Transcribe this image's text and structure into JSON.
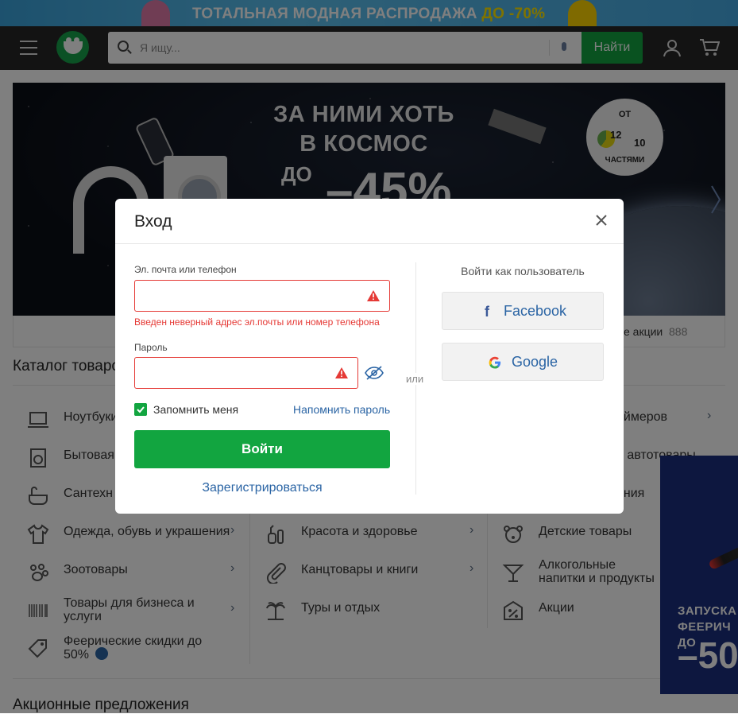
{
  "promo_bar": {
    "text_main": "ТОТАЛЬНАЯ МОДНАЯ РАСПРОДАЖА ",
    "text_highlight": "ДО -70%"
  },
  "header": {
    "search_placeholder": "Я ищу...",
    "find_button": "Найти",
    "icons": [
      "menu-icon",
      "logo-icon",
      "search-icon",
      "microphone-icon",
      "user-icon",
      "cart-icon"
    ]
  },
  "banner": {
    "headline": "ЗА НИМИ ХОТЬ В КОСМОС",
    "sub": "ДО",
    "percent": "–45%",
    "badge": {
      "from": "ОТ",
      "n1": "12",
      "n2": "10",
      "parts": "ЧАСТЯМИ"
    }
  },
  "promo_links": {
    "text": "е акции",
    "count": "888"
  },
  "catalog": {
    "title": "Каталог товаров",
    "col1": [
      {
        "label": "Ноутбуки",
        "icon": "laptop-icon"
      },
      {
        "label": "Бытовая",
        "icon": "washer-icon"
      },
      {
        "label": "Сантехн",
        "icon": "bathtub-icon"
      },
      {
        "label": "Одежда, обувь и украшения",
        "icon": "shirt-icon"
      },
      {
        "label": "Зоотовары",
        "icon": "paw-icon"
      },
      {
        "label": "Товары для бизнеса и услуги",
        "icon": "barcode-icon"
      },
      {
        "label": "Феерические скидки до 50%",
        "icon": "tag-icon"
      }
    ],
    "col2": [
      {
        "label": "Красота и здоровье",
        "icon": "cosmetics-icon"
      },
      {
        "label": "Канцтовары и книги",
        "icon": "paperclip-icon"
      },
      {
        "label": "Туры и отдых",
        "icon": "palm-icon"
      }
    ],
    "col3": [
      {
        "label": "еймеров",
        "icon": ""
      },
      {
        "label": "и автотовары",
        "icon": ""
      },
      {
        "label": "ения",
        "icon": ""
      },
      {
        "label": "Детские товары",
        "icon": "bear-icon"
      },
      {
        "label": "Алкогольные напитки и продукты",
        "icon": "cocktail-icon"
      },
      {
        "label": "Акции",
        "icon": "percent-tag-icon"
      }
    ]
  },
  "offers_title": "Акционные предложения",
  "side_ad": {
    "line1": "ЗАПУСКА",
    "line2": "ФЕЕРИЧ",
    "line3": "ДО",
    "big": "–50"
  },
  "modal": {
    "title": "Вход",
    "email_label": "Эл. почта или телефон",
    "email_value": "",
    "email_error": "Введен неверный адрес эл.почты или номер телефона",
    "password_label": "Пароль",
    "password_value": "",
    "remember_label": "Запомнить меня",
    "remember_checked": true,
    "forgot_link": "Напомнить пароль",
    "login_button": "Войти",
    "register_link": "Зарегистрироваться",
    "or": "или",
    "login_as": "Войти как пользователь",
    "social": [
      {
        "label": "Facebook",
        "icon": "facebook-icon"
      },
      {
        "label": "Google",
        "icon": "google-icon"
      }
    ]
  },
  "colors": {
    "accent_green": "#12a540",
    "link_blue": "#2a64a4",
    "error_red": "#e53935",
    "header_dark": "#262626"
  }
}
